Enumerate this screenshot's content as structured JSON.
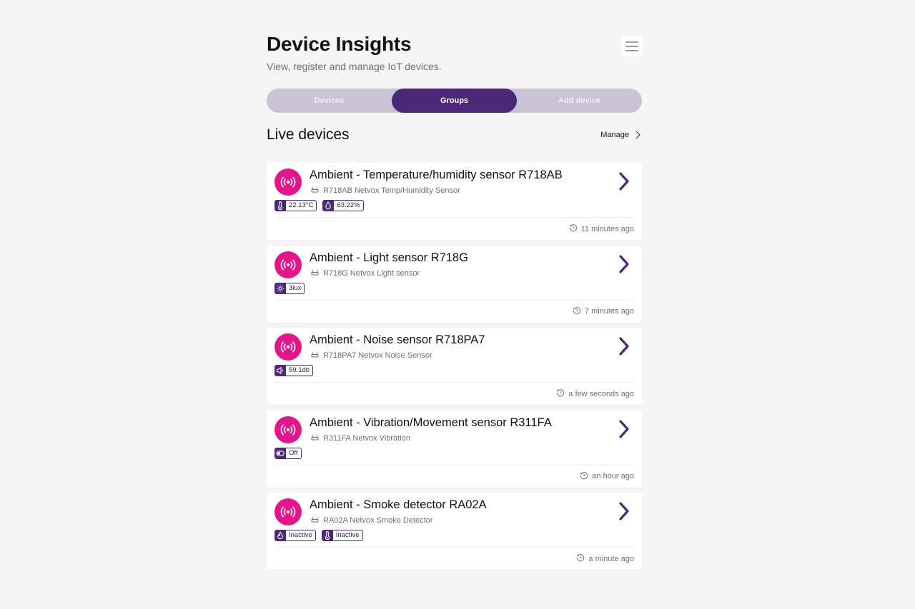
{
  "header": {
    "title": "Device Insights",
    "subtitle": "View, register and manage IoT devices."
  },
  "tabs": [
    {
      "label": "Devices",
      "active": false
    },
    {
      "label": "Groups",
      "active": true
    },
    {
      "label": "Add device",
      "active": false
    }
  ],
  "section": {
    "title": "Live devices",
    "manage_label": "Manage"
  },
  "colors": {
    "accent": "#4b2878",
    "avatar": "#e4148b",
    "tab_track": "#c9c3d6"
  },
  "devices": [
    {
      "title": "Ambient - Temperature/humidity sensor R718AB",
      "model": "R718AB Netvox Temp/Humidity Sensor",
      "badges": [
        {
          "icon": "thermometer-icon",
          "value": "22.13°C"
        },
        {
          "icon": "droplet-icon",
          "value": "63.22%"
        }
      ],
      "time": "11 minutes ago"
    },
    {
      "title": "Ambient - Light sensor R718G",
      "model": "R718G Netvox Light sensor",
      "badges": [
        {
          "icon": "sun-icon",
          "value": "3lux"
        }
      ],
      "time": "7 minutes ago"
    },
    {
      "title": "Ambient - Noise sensor R718PA7",
      "model": "R718PA7 Netvox Noise Sensor",
      "badges": [
        {
          "icon": "speaker-icon",
          "value": "59.1db"
        }
      ],
      "time": "a few seconds ago"
    },
    {
      "title": "Ambient - Vibration/Movement sensor R311FA",
      "model": "R311FA Netvox Vibration",
      "badges": [
        {
          "icon": "toggle-icon",
          "value": "Off"
        }
      ],
      "time": "an hour ago"
    },
    {
      "title": "Ambient - Smoke detector RA02A",
      "model": "RA02A Netvox Smoke Detector",
      "badges": [
        {
          "icon": "flame-icon",
          "value": "Inactive"
        },
        {
          "icon": "thermometer-icon",
          "value": "Inactive"
        }
      ],
      "time": "a minute ago"
    }
  ]
}
